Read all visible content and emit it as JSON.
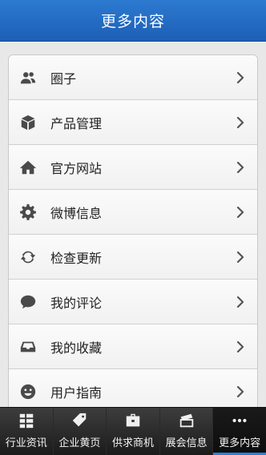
{
  "header": {
    "title": "更多内容"
  },
  "menu": {
    "items": [
      {
        "label": "圈子",
        "icon": "group-icon"
      },
      {
        "label": "产品管理",
        "icon": "cube-icon"
      },
      {
        "label": "官方网站",
        "icon": "home-icon"
      },
      {
        "label": "微博信息",
        "icon": "gear-icon"
      },
      {
        "label": "检查更新",
        "icon": "refresh-icon"
      },
      {
        "label": "我的评论",
        "icon": "comment-icon"
      },
      {
        "label": "我的收藏",
        "icon": "inbox-icon"
      },
      {
        "label": "用户指南",
        "icon": "smiley-icon"
      }
    ]
  },
  "tabbar": {
    "tabs": [
      {
        "label": "行业资讯",
        "icon": "list-icon"
      },
      {
        "label": "企业黄页",
        "icon": "tag-icon"
      },
      {
        "label": "供求商机",
        "icon": "briefcase-icon"
      },
      {
        "label": "展会信息",
        "icon": "frame-icon"
      },
      {
        "label": "更多内容",
        "icon": "more-icon"
      }
    ],
    "active_index": 4
  },
  "colors": {
    "header_bg": "#1c5fb5",
    "tab_active_indicator": "#2f7fd6"
  }
}
